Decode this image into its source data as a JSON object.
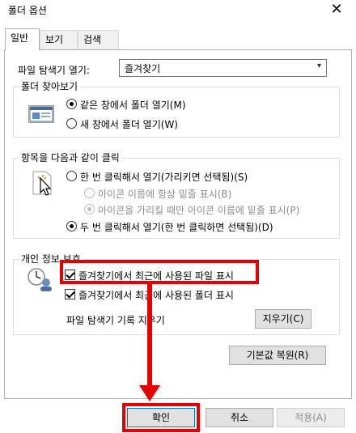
{
  "window": {
    "title": "폴더 옵션",
    "close_glyph": "✕"
  },
  "tabs": [
    {
      "label": "일반",
      "active": true
    },
    {
      "label": "보기",
      "active": false
    },
    {
      "label": "검색",
      "active": false
    }
  ],
  "explorer_open": {
    "label": "파일 탐색기 열기:",
    "value": "즐겨찾기",
    "arrow": "▾"
  },
  "browse": {
    "title": "폴더 찾아보기",
    "icon": "folder-window-icon",
    "options": [
      {
        "label": "같은 창에서 폴더 열기(M)",
        "selected": true
      },
      {
        "label": "새 창에서 폴더 열기(W)",
        "selected": false
      }
    ]
  },
  "click": {
    "title": "항목을 다음과 같이 클릭",
    "icon": "pointer-click-icon",
    "options": [
      {
        "label": "한 번 클릭해서 열기(가리키면 선택됨)(S)",
        "selected": false,
        "enabled": true
      },
      {
        "label": "아이콘 이름에 항상 밑줄 표시(B)",
        "selected": false,
        "enabled": false
      },
      {
        "label": "아이콘을 가리킬 때만 아이콘 이름에 밑줄 표시(P)",
        "selected": true,
        "enabled": false
      },
      {
        "label": "두 번 클릭해서 열기(한 번 클릭하면 선택됨)(D)",
        "selected": true,
        "enabled": true
      }
    ]
  },
  "privacy": {
    "title": "개인 정보 보호",
    "icon": "clock-user-icon",
    "checks": [
      {
        "label": "즐겨찾기에서 최근에 사용된 파일 표시",
        "checked": true
      },
      {
        "label": "즐겨찾기에서 최근에 사용된 폴더 표시",
        "checked": true
      }
    ],
    "history_label": "파일 탐색기 기록 지우기",
    "clear_button": "지우기(C)"
  },
  "restore_button": "기본값 복원(R)",
  "footer": {
    "ok": "확인",
    "cancel": "취소",
    "apply": "적용(A)"
  },
  "colors": {
    "highlight": "#e60000",
    "accent": "#0078d7"
  }
}
